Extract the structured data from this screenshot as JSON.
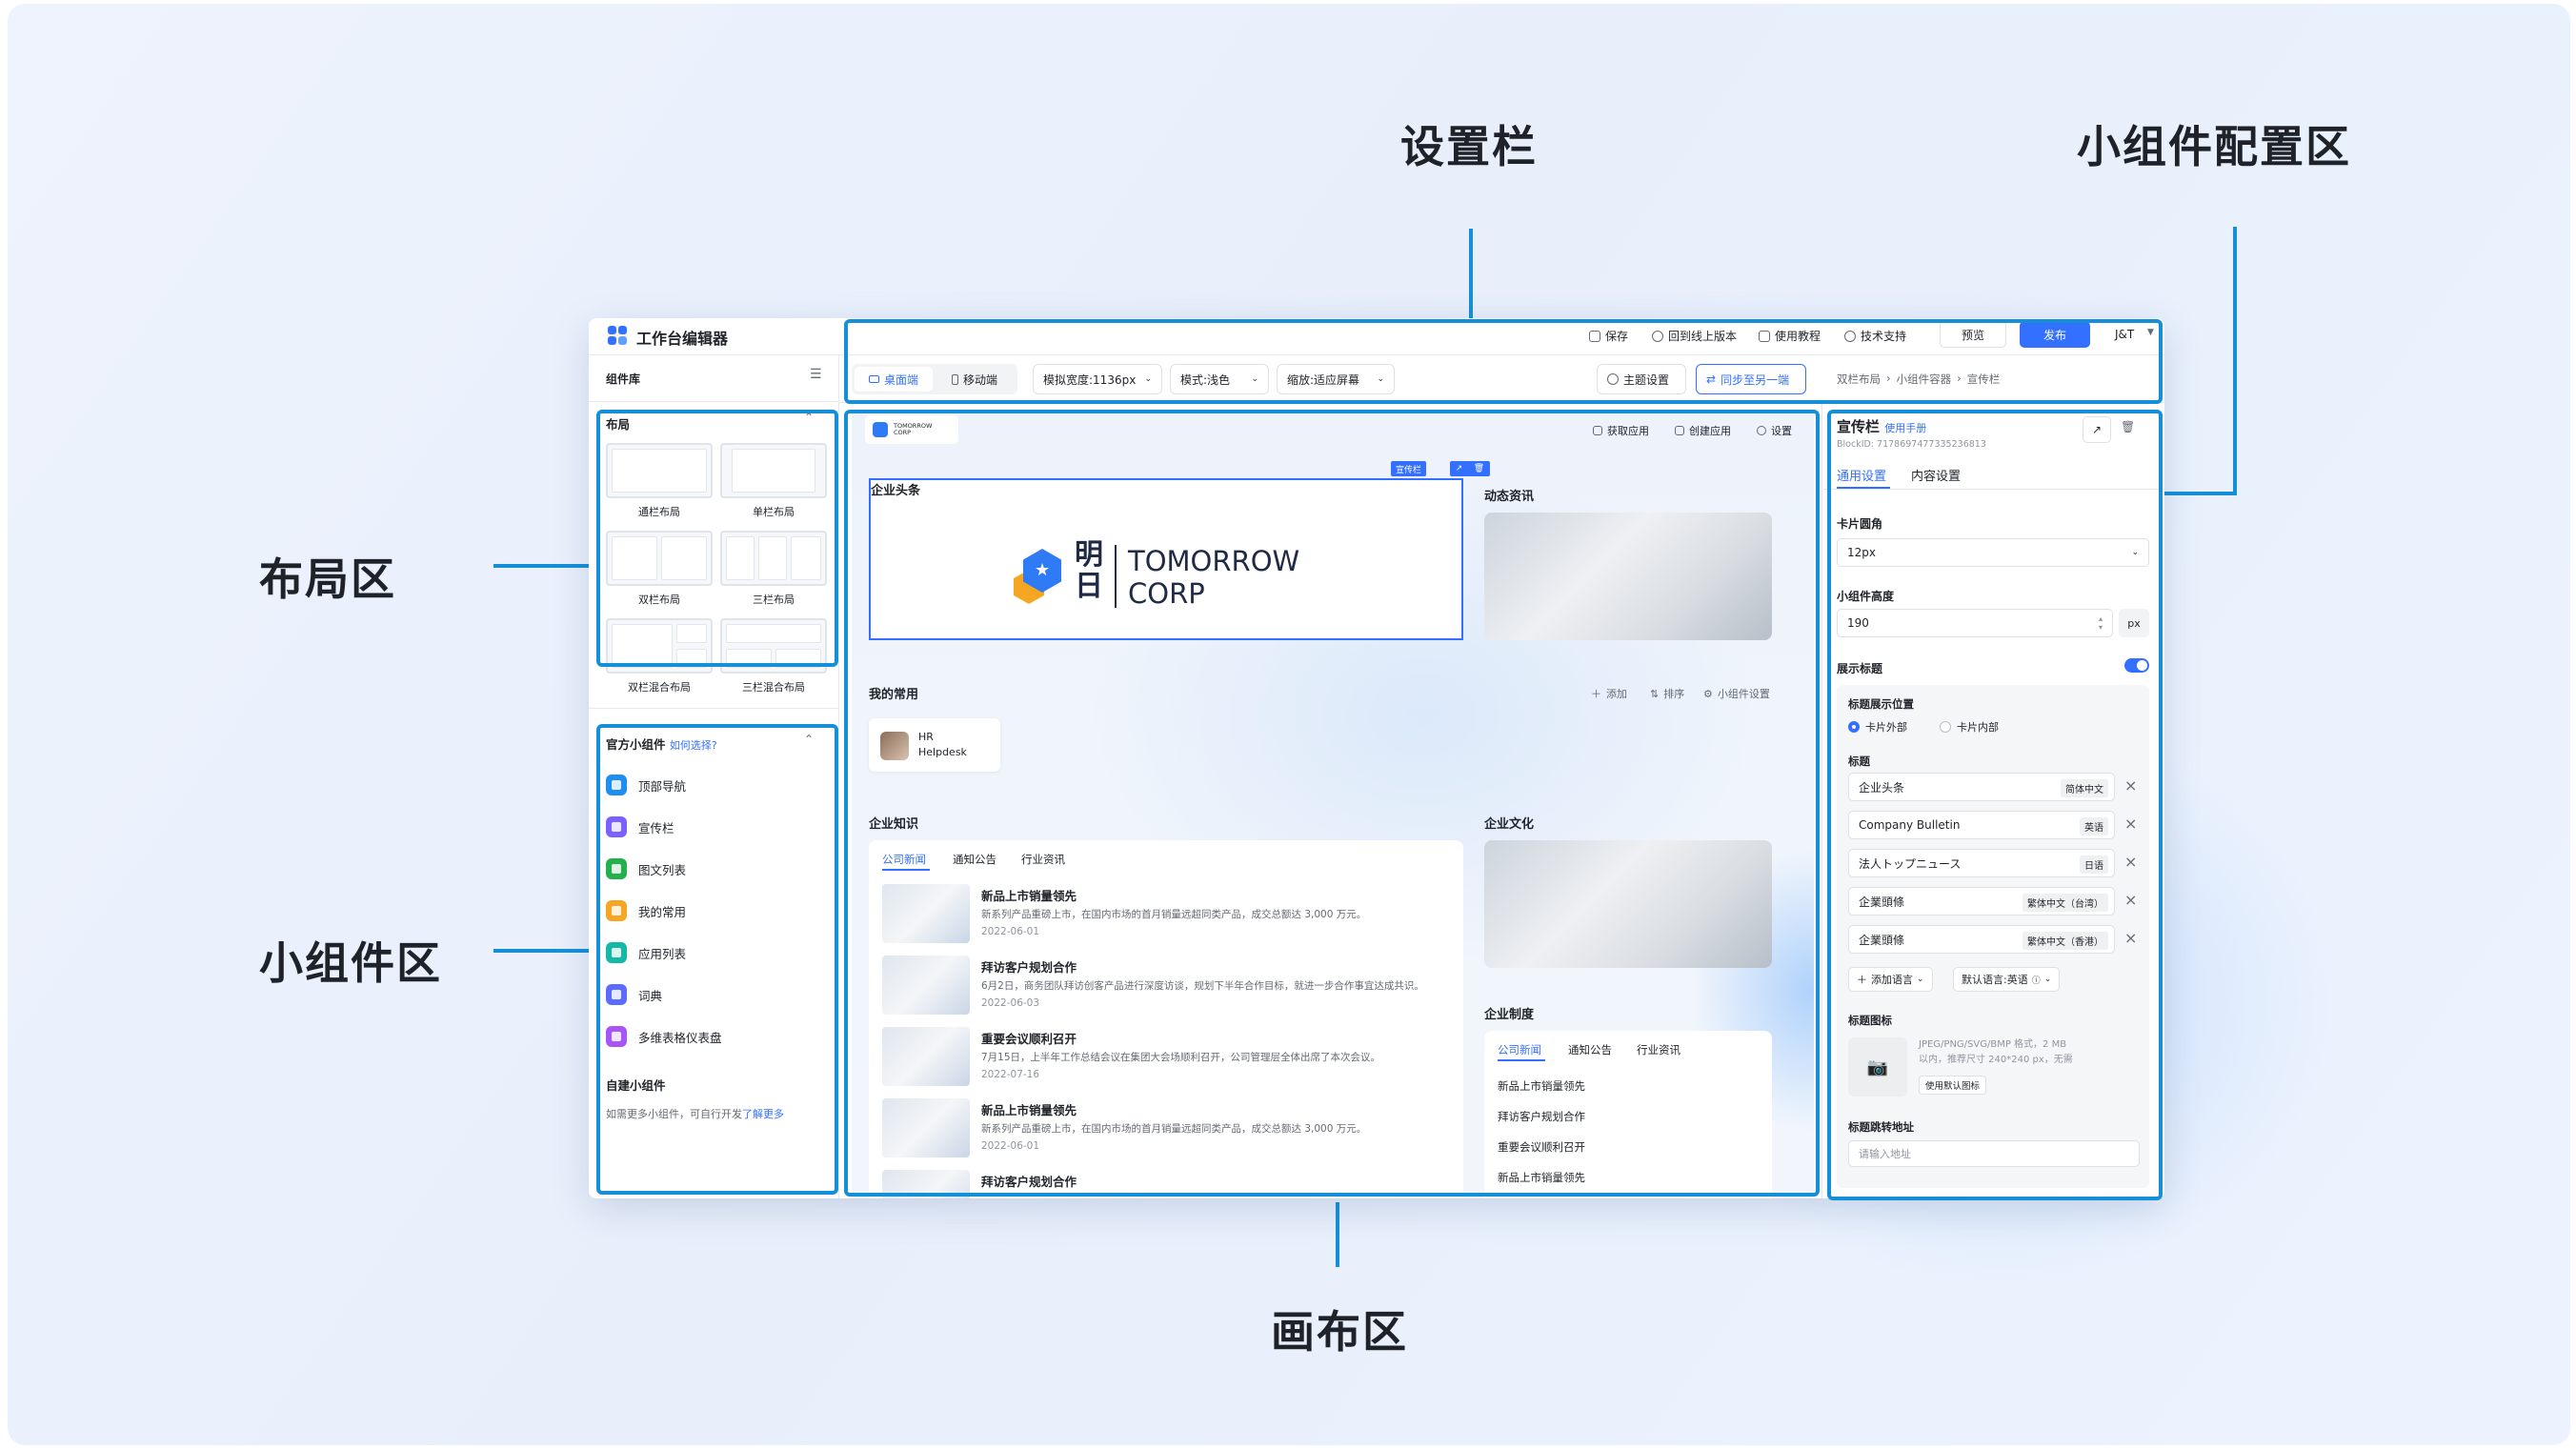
{
  "callouts": {
    "settings_bar": "设置栏",
    "widget_config": "小组件配置区",
    "layout_area": "布局区",
    "widget_area": "小组件区",
    "canvas_area": "画布区"
  },
  "app": {
    "title": "工作台编辑器",
    "top_actions": {
      "save": "保存",
      "rollback": "回到线上版本",
      "tutorial": "使用教程",
      "support": "技术支持",
      "preview": "预览",
      "publish": "发布",
      "user": "J&T"
    },
    "settings": {
      "desktop": "桌面端",
      "mobile": "移动端",
      "sim_width": "模拟宽度:1136px",
      "mode": "模式:浅色",
      "zoom": "缩放:适应屏幕",
      "theme": "主题设置",
      "sync": "同步至另一端"
    },
    "breadcrumb": [
      "双栏布局",
      "小组件容器",
      "宣传栏"
    ],
    "library": {
      "title": "组件库",
      "layout_section": "布局",
      "layouts": [
        "通栏布局",
        "单栏布局",
        "双栏布局",
        "三栏布局",
        "双栏混合布局",
        "三栏混合布局"
      ],
      "official_title": "官方小组件",
      "how_to_choose": "如何选择?",
      "widgets": [
        {
          "label": "顶部导航",
          "color": "#1f8ef1"
        },
        {
          "label": "宣传栏",
          "color": "#7b61ff"
        },
        {
          "label": "图文列表",
          "color": "#23b14d"
        },
        {
          "label": "我的常用",
          "color": "#f5a623"
        },
        {
          "label": "应用列表",
          "color": "#14b8a6"
        },
        {
          "label": "词典",
          "color": "#5b6cff"
        },
        {
          "label": "多维表格仪表盘",
          "color": "#a855f7"
        }
      ],
      "custom_title": "自建小组件",
      "custom_desc": "如需更多小组件，可自行开发",
      "learn_more": "了解更多"
    },
    "canvas": {
      "logo_text": "TOMORROW CORP",
      "get_app": "获取应用",
      "create_app": "创建应用",
      "settings": "设置",
      "selected_tag": "宣传栏",
      "headline_title": "企业头条",
      "banner_cn": "明日",
      "banner_en1": "TOMORROW",
      "banner_en2": "CORP",
      "dynamic_title": "动态资讯",
      "frequent_title": "我的常用",
      "add": "添加",
      "sort": "排序",
      "widget_settings": "小组件设置",
      "hr_line1": "HR",
      "hr_line2": "Helpdesk",
      "knowledge_title": "企业知识",
      "culture_title": "企业文化",
      "policy_title": "企业制度",
      "tabs": [
        "公司新闻",
        "通知公告",
        "行业资讯"
      ],
      "news": [
        {
          "title": "新品上市销量领先",
          "desc": "新系列产品重磅上市，在国内市场的首月销量远超同类产品，成交总额达 3,000 万元。",
          "date": "2022-06-01"
        },
        {
          "title": "拜访客户规划合作",
          "desc": "6月2日，商务团队拜访创客产品进行深度访谈，规划下半年合作目标，就进一步合作事宜达成共识。",
          "date": "2022-06-03"
        },
        {
          "title": "重要会议顺利召开",
          "desc": "7月15日，上半年工作总结会议在集团大会场顺利召开，公司管理层全体出席了本次会议。",
          "date": "2022-07-16"
        },
        {
          "title": "新品上市销量领先",
          "desc": "新系列产品重磅上市，在国内市场的首月销量远超同类产品，成交总额达 3,000 万元。",
          "date": "2022-06-01"
        },
        {
          "title": "拜访客户规划合作",
          "desc": "",
          "date": ""
        }
      ],
      "policy_items": [
        "新品上市销量领先",
        "拜访客户规划合作",
        "重要会议顺利召开",
        "新品上市销量领先"
      ]
    },
    "config": {
      "title": "宣传栏",
      "manual": "使用手册",
      "block_id": "BlockID: 7178697477335236813",
      "tab_general": "通用设置",
      "tab_content": "内容设置",
      "radius_label": "卡片圆角",
      "radius_value": "12px",
      "height_label": "小组件高度",
      "height_value": "190",
      "height_unit": "px",
      "show_title_label": "展示标题",
      "title_pos_label": "标题展示位置",
      "pos_outside": "卡片外部",
      "pos_inside": "卡片内部",
      "title_label": "标题",
      "titles": [
        {
          "text": "企业头条",
          "lang": "简体中文"
        },
        {
          "text": "Company Bulletin",
          "lang": "英语"
        },
        {
          "text": "法人トップニュース",
          "lang": "日语"
        },
        {
          "text": "企業頭條",
          "lang": "繁体中文（台湾）"
        },
        {
          "text": "企業頭條",
          "lang": "繁体中文（香港）"
        }
      ],
      "add_language": "添加语言",
      "default_language": "默认语言:英语",
      "icon_label": "标题图标",
      "icon_hint1": "JPEG/PNG/SVG/BMP 格式，2 MB",
      "icon_hint2": "以内，推荐尺寸 240*240 px，无需",
      "icon_hint3": "加",
      "use_default_icon": "使用默认图标",
      "jump_label": "标题跳转地址",
      "jump_placeholder": "请输入地址"
    }
  },
  "colors": {
    "accent": "#1590d8",
    "primary": "#3370ff"
  }
}
